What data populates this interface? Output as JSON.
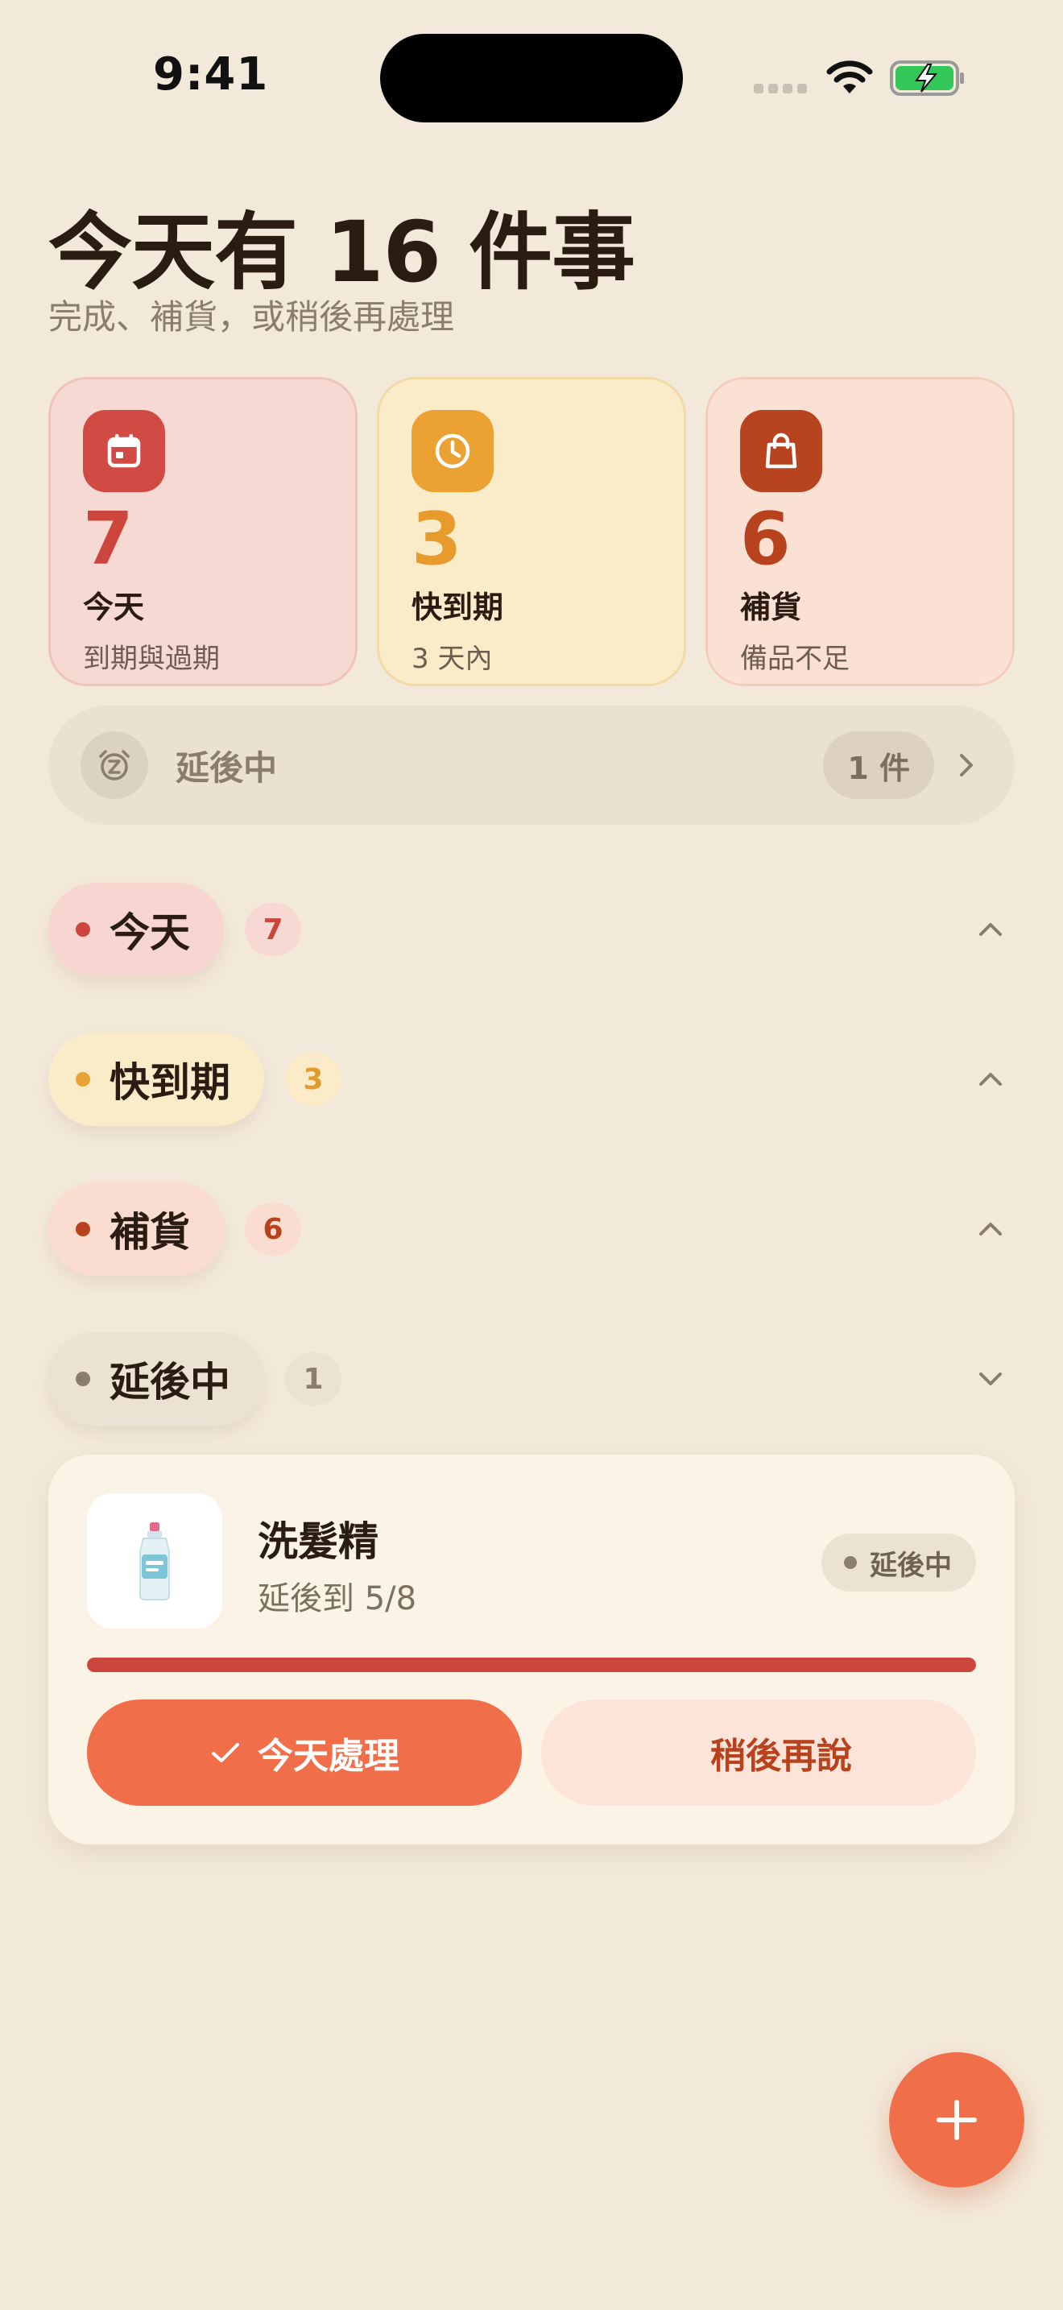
{
  "status_bar": {
    "time": "9:41"
  },
  "header": {
    "title": "今天有 16 件事",
    "subtitle": "完成、補貨，或稍後再處理"
  },
  "summary_cards": [
    {
      "icon": "calendar-icon",
      "count": "7",
      "label": "今天",
      "sub": "到期與過期",
      "color": "#cc463e"
    },
    {
      "icon": "clock-icon",
      "count": "3",
      "label": "快到期",
      "sub": "3 天內",
      "color": "#e79b2c"
    },
    {
      "icon": "shopping-bag-icon",
      "count": "6",
      "label": "補貨",
      "sub": "備品不足",
      "color": "#b8421d"
    }
  ],
  "snooze_bar": {
    "icon": "alarm-snooze-icon",
    "label": "延後中",
    "count": "1 件"
  },
  "sections": [
    {
      "label": "今天",
      "count": "7",
      "expanded": true
    },
    {
      "label": "快到期",
      "count": "3",
      "expanded": true
    },
    {
      "label": "補貨",
      "count": "6",
      "expanded": true
    },
    {
      "label": "延後中",
      "count": "1",
      "expanded": false
    }
  ],
  "snoozed_item": {
    "icon": "shampoo-bottle-icon",
    "name": "洗髮精",
    "sub": "延後到 5/8",
    "status": "延後中",
    "progress": 1.0,
    "primary_action": "今天處理",
    "secondary_action": "稍後再說"
  },
  "fab": {
    "icon": "plus-icon"
  },
  "colors": {
    "background": "#f3e9da",
    "accent": "#f06e49",
    "today": "#cc463e",
    "soon": "#e79b2c",
    "restock": "#b8421d"
  }
}
